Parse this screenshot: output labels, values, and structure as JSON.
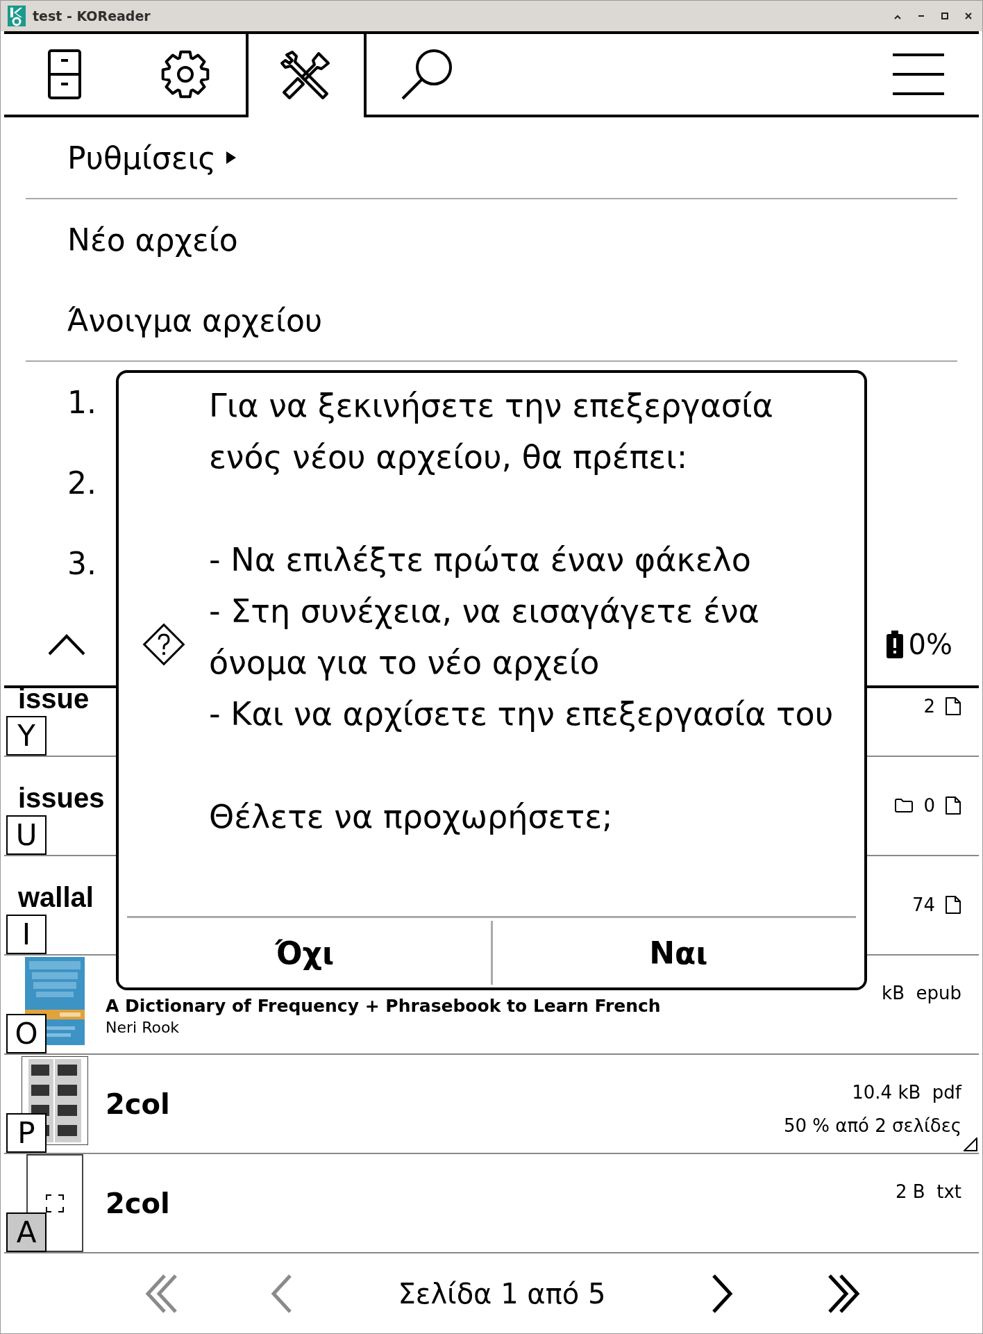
{
  "window": {
    "title": "test - KOReader"
  },
  "tabs": [
    {
      "kind": "filemanager",
      "selected": false
    },
    {
      "kind": "settings",
      "selected": false
    },
    {
      "kind": "tools",
      "selected": true
    },
    {
      "kind": "search",
      "selected": false
    },
    {
      "kind": "menu",
      "selected": false
    }
  ],
  "menu": {
    "items": [
      {
        "kind": "submenu",
        "label": "Ρυθμίσεις",
        "divider_after": true
      },
      {
        "kind": "action",
        "label": "Νέο αρχείο",
        "divider_after": false
      },
      {
        "kind": "action",
        "label": "Άνοιγμα αρχείου",
        "divider_after": true
      },
      {
        "kind": "action",
        "label": "1.",
        "divider_after": false
      },
      {
        "kind": "action",
        "label": "2.",
        "divider_after": false
      },
      {
        "kind": "action",
        "label": "3.",
        "divider_after": false
      }
    ],
    "battery": "0%"
  },
  "files": [
    {
      "kind": "folder",
      "key": "Y",
      "key_highlighted": false,
      "title": "issue",
      "counts": [
        {
          "kind": "number",
          "text": "2"
        },
        {
          "kind": "file"
        }
      ],
      "dogear": false
    },
    {
      "kind": "folder",
      "key": "U",
      "key_highlighted": false,
      "title": "issues",
      "counts": [
        {
          "kind": "folder"
        },
        {
          "kind": "number",
          "text": "0"
        },
        {
          "kind": "file"
        }
      ],
      "dogear": false
    },
    {
      "kind": "folder",
      "key": "I",
      "key_highlighted": false,
      "title": "wallal",
      "counts": [
        {
          "kind": "number",
          "text": "74"
        },
        {
          "kind": "file"
        }
      ],
      "dogear": false
    },
    {
      "kind": "book",
      "key": "O",
      "key_highlighted": false,
      "thumbnail": {
        "kind": "cover"
      },
      "title": "A Dictionary of Frequency + Phrasebook to Learn French",
      "author": "Neri Rook",
      "info": [
        "kB  epub"
      ],
      "dogear": false
    },
    {
      "kind": "book",
      "key": "P",
      "key_highlighted": false,
      "thumbnail": {
        "kind": "pages"
      },
      "title": "2col",
      "info": [
        "10.4 kB  pdf",
        "50 % από 2 σελίδες"
      ],
      "dogear": true
    },
    {
      "kind": "book",
      "key": "A",
      "key_highlighted": true,
      "thumbnail": {
        "kind": "blank"
      },
      "title": "2col",
      "info": [
        "2 B  txt"
      ],
      "dogear": false
    }
  ],
  "dialog": {
    "message": "Για να ξεκινήσετε την επεξεργασία ενός νέου αρχείου, θα πρέπει:\n\n- Να επιλέξτε πρώτα έναν φάκελο\n- Στη συνέχεια, να εισαγάγετε ένα όνομα για το νέο αρχείο\n- Και να αρχίσετε την επεξεργασία του\n\nΘέλετε να προχωρήσετε;",
    "buttons": [
      "Όχι",
      "Ναι"
    ]
  },
  "footer": {
    "page": "Σελίδα 1 από 5",
    "nav": [
      {
        "kind": "first",
        "disabled": true
      },
      {
        "kind": "prev",
        "disabled": true
      },
      {
        "kind": "next",
        "disabled": false
      },
      {
        "kind": "last",
        "disabled": false
      }
    ]
  }
}
